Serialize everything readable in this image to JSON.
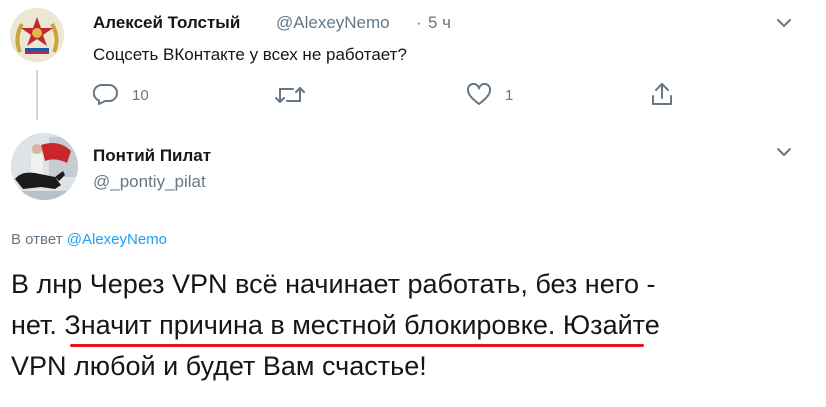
{
  "tweet1": {
    "author_name": "Алексей Толстый",
    "author_handle": "@AlexeyNemo",
    "separator": "·",
    "time": "5 ч",
    "text": "Соцсеть ВКонтакте у всех не работает?",
    "actions": {
      "reply_icon": "reply-icon",
      "reply_count": "10",
      "retweet_icon": "retweet-icon",
      "like_icon": "heart-icon",
      "like_count": "1",
      "share_icon": "share-icon"
    }
  },
  "tweet2": {
    "author_name": "Понтий Пилат",
    "author_handle": "@_pontiy_pilat",
    "reply_prefix": "В ответ",
    "reply_to": "@AlexeyNemo",
    "text_line1": "В лнр Через VPN всё начинает работать, без него -",
    "text_line2_a": "нет.",
    "text_line2_b": "Значит причина в местной блокировке",
    "text_line2_c": ". Юзайте",
    "text_line3": "VPN любой и будет Вам счастье!"
  },
  "colors": {
    "text": "#14171a",
    "secondary": "#657786",
    "link": "#1da1f2",
    "annotation": "#e3191f",
    "thread_line": "#ccd6dd"
  }
}
